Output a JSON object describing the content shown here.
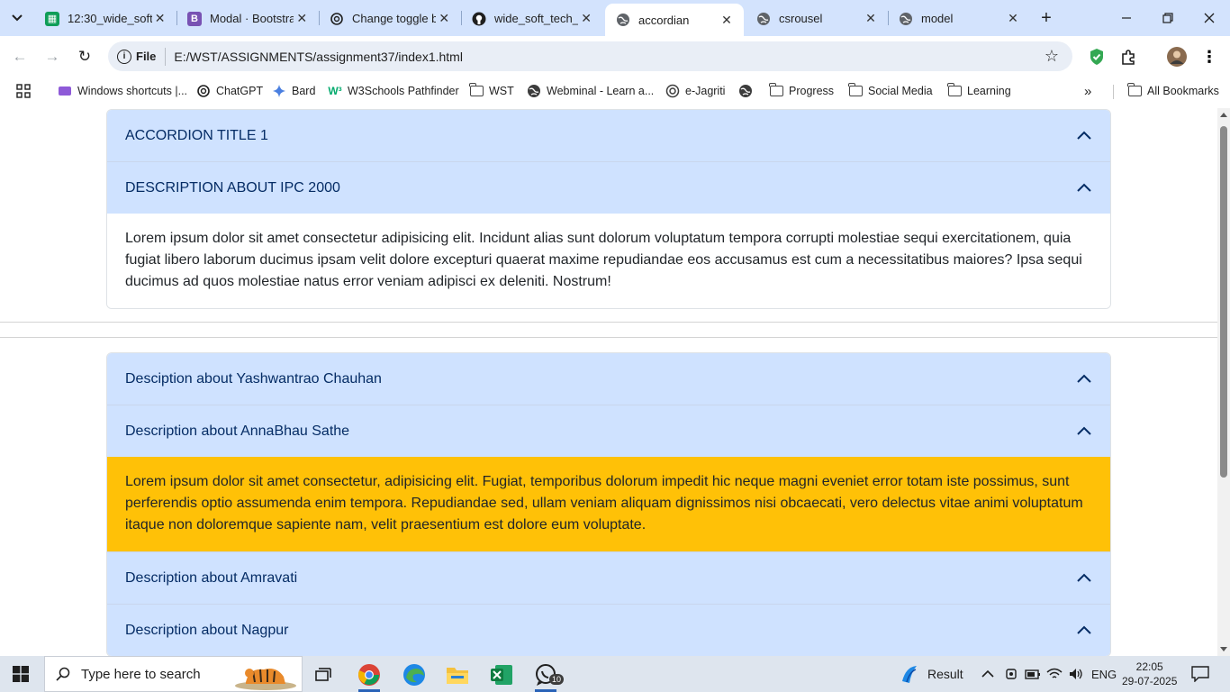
{
  "browser": {
    "tabs": [
      {
        "title": "12:30_wide_soft_",
        "icon": "sheets-icon",
        "color": "#0f9d58"
      },
      {
        "title": "Modal · Bootstra",
        "icon": "bootstrap-icon",
        "color": "#7952b3"
      },
      {
        "title": "Change toggle b",
        "icon": "chatgpt-icon",
        "color": "#1f1f1f"
      },
      {
        "title": "wide_soft_tech_",
        "icon": "github-icon",
        "color": "#1f1f1f"
      },
      {
        "title": "accordian",
        "icon": "globe-icon",
        "color": "#1f1f1f",
        "active": true
      },
      {
        "title": "csrousel",
        "icon": "globe-icon",
        "color": "#1f1f1f"
      },
      {
        "title": "model",
        "icon": "globe-icon",
        "color": "#1f1f1f"
      }
    ],
    "address": {
      "scheme": "File",
      "url": "E:/WST/ASSIGNMENTS/assignment37/index1.html"
    },
    "bookmarks": [
      {
        "label": "Windows shortcuts |...",
        "icon": "windows-shortcuts-icon"
      },
      {
        "label": "ChatGPT",
        "icon": "chatgpt-icon"
      },
      {
        "label": "Bard",
        "icon": "bard-icon"
      },
      {
        "label": "W3Schools Pathfinder",
        "icon": "w3schools-icon"
      },
      {
        "label": "WST",
        "icon": "folder-icon"
      },
      {
        "label": "Webminal - Learn a...",
        "icon": "globe-icon"
      },
      {
        "label": "e-Jagriti",
        "icon": "e-jagriti-icon"
      },
      {
        "label": "",
        "icon": "globe-icon"
      },
      {
        "label": "Progress",
        "icon": "folder-icon"
      },
      {
        "label": "Social Media",
        "icon": "folder-icon"
      },
      {
        "label": "Learning",
        "icon": "folder-icon"
      }
    ],
    "all_bookmarks": "All Bookmarks"
  },
  "page": {
    "accordion1": {
      "items": [
        {
          "title": "ACCORDION TITLE 1",
          "body": ""
        },
        {
          "title": "DESCRIPTION ABOUT IPC 2000",
          "body": "Lorem ipsum dolor sit amet consectetur adipisicing elit. Incidunt alias sunt dolorum voluptatum tempora corrupti molestiae sequi exercitationem, quia fugiat libero laborum ducimus ipsam velit dolore excepturi quaerat maxime repudiandae eos accusamus est cum a necessitatibus maiores? Ipsa sequi ducimus ad quos molestiae natus error veniam adipisci ex deleniti. Nostrum!"
        }
      ]
    },
    "accordion2": {
      "items": [
        {
          "title": "Desciption about Yashwantrao Chauhan",
          "body": ""
        },
        {
          "title": "Description about AnnaBhau Sathe",
          "body": "Lorem ipsum dolor sit amet consectetur, adipisicing elit. Fugiat, temporibus dolorum impedit hic neque magni eveniet error totam iste possimus, sunt perferendis optio assumenda enim tempora. Repudiandae sed, ullam veniam aliquam dignissimos nisi obcaecati, vero delectus vitae animi voluptatum itaque non doloremque sapiente nam, velit praesentium est dolore eum voluptate."
        },
        {
          "title": "Description about Amravati",
          "body": ""
        },
        {
          "title": "Description about Nagpur",
          "body": ""
        }
      ]
    },
    "colors": {
      "header_bg": "#cfe2ff",
      "warning_bg": "#ffc107",
      "header_text": "#052c65"
    }
  },
  "taskbar": {
    "search_placeholder": "Type here to search",
    "weather": "Result",
    "language": "ENG",
    "time": "22:05",
    "date": "29-07-2025",
    "whatsapp_badge": "10"
  }
}
